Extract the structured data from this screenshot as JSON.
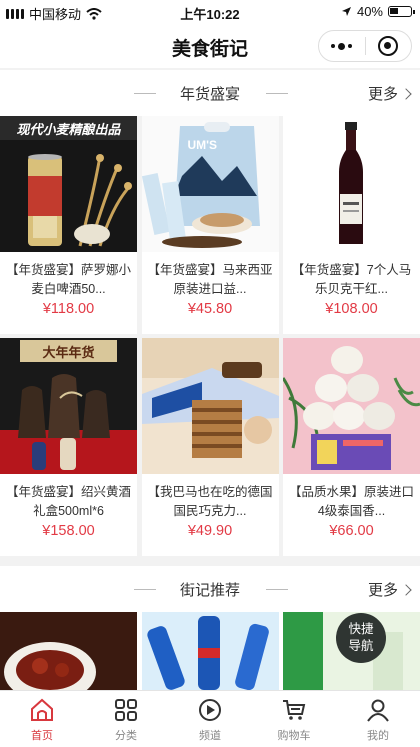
{
  "status_bar": {
    "carrier": "中国移动",
    "time": "上午10:22",
    "battery": "40%"
  },
  "navbar": {
    "title": "美食街记"
  },
  "sections": [
    {
      "title": "年货盛宴",
      "more": "更多",
      "products": [
        {
          "name": "【年货盛宴】萨罗娜小麦白啤酒50...",
          "price": "¥118.00",
          "image_text": "现代小麦精酿出品"
        },
        {
          "name": "【年货盛宴】马来西亚原装进口益...",
          "price": "¥45.80",
          "image_text": "UM'S"
        },
        {
          "name": "【年货盛宴】7个人马乐贝克干红...",
          "price": "¥108.00",
          "image_text": ""
        },
        {
          "name": "【年货盛宴】绍兴黄酒礼盒500ml*6",
          "price": "¥158.00",
          "image_text": "大年年货"
        },
        {
          "name": "【我巴马也在吃的德国国民巧克力...",
          "price": "¥49.90",
          "image_text": ""
        },
        {
          "name": "【品质水果】原装进口4级泰国香...",
          "price": "¥66.00",
          "image_text": ""
        }
      ]
    },
    {
      "title": "街记推荐",
      "more": "更多"
    }
  ],
  "fab": {
    "line1": "快捷",
    "line2": "导航"
  },
  "tabbar": [
    {
      "label": "首页",
      "icon": "home-icon",
      "active": true
    },
    {
      "label": "分类",
      "icon": "grid-icon",
      "active": false
    },
    {
      "label": "频道",
      "icon": "play-icon",
      "active": false
    },
    {
      "label": "购物车",
      "icon": "cart-icon",
      "active": false
    },
    {
      "label": "我的",
      "icon": "person-icon",
      "active": false
    }
  ],
  "colors": {
    "accent": "#e23a45",
    "tab_active": "#d8383e"
  }
}
